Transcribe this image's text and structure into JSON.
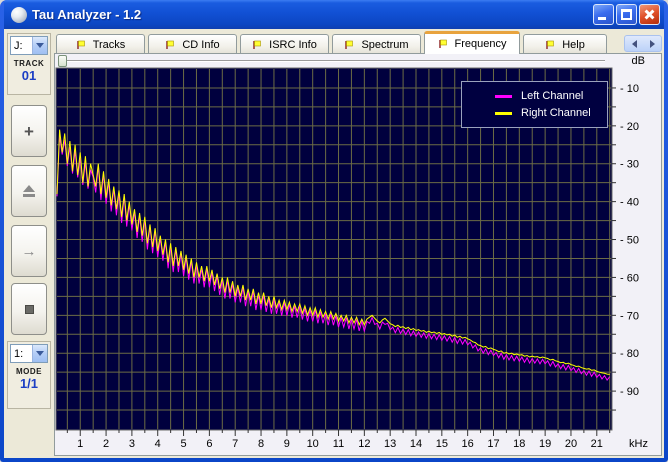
{
  "window": {
    "title": "Tau Analyzer - 1.2"
  },
  "tabs": {
    "items": [
      {
        "label": "Tracks",
        "active": false
      },
      {
        "label": "CD Info",
        "active": false
      },
      {
        "label": "ISRC Info",
        "active": false
      },
      {
        "label": "Spectrum",
        "active": false
      },
      {
        "label": "Frequency",
        "active": true
      },
      {
        "label": "Help",
        "active": false
      }
    ]
  },
  "sidebar": {
    "drive_combo": {
      "value": "J:"
    },
    "track": {
      "label": "TRACK",
      "value": "01"
    },
    "buttons": {
      "add_glyph": "+",
      "play_glyph": "→"
    },
    "mode_combo": {
      "value": "1:"
    },
    "mode": {
      "label": "MODE",
      "value": "1/1"
    }
  },
  "colors": {
    "plot_bg": "#00003e",
    "grid": "#6c6c45",
    "plot_border": "#6a6a6a",
    "tick": "#333333",
    "left_channel": "#ff00ff",
    "right_channel": "#ffff00",
    "active_tab_accent": "#e8a33d"
  },
  "chart_data": {
    "type": "line",
    "title": "",
    "x_unit": "kHz",
    "y_unit": "dB",
    "xlim": [
      0.1,
      21.55
    ],
    "ylim": [
      -100,
      -5
    ],
    "x_grid_step": 0.5,
    "y_grid_step": 5,
    "x_tick_labels": [
      "1",
      "2",
      "3",
      "4",
      "5",
      "6",
      "7",
      "8",
      "9",
      "10",
      "11",
      "12",
      "13",
      "14",
      "15",
      "16",
      "17",
      "18",
      "19",
      "20",
      "21"
    ],
    "y_tick_values": [
      -10,
      -20,
      -30,
      -40,
      -50,
      -60,
      -70,
      -80,
      -90
    ],
    "y_tick_labels": [
      "- 10",
      "- 20",
      "- 30",
      "- 40",
      "- 50",
      "- 60",
      "- 70",
      "- 80",
      "- 90"
    ],
    "legend": {
      "position": "top-right",
      "items": [
        {
          "name": "Left Channel",
          "color": "#ff00ff"
        },
        {
          "name": "Right Channel",
          "color": "#ffff00"
        }
      ]
    },
    "series": [
      {
        "name": "Left Channel",
        "color": "#ff00ff",
        "freq_start": 0.1,
        "freq_step": 0.1,
        "values_db": [
          -38.6,
          -22.6,
          -27.6,
          -23.6,
          -30.6,
          -25.6,
          -32.6,
          -26.6,
          -33.6,
          -28.6,
          -35.6,
          -29.6,
          -36.6,
          -31.6,
          -33.6,
          -37.6,
          -30.6,
          -39.6,
          -32.6,
          -40.6,
          -34.6,
          -42.6,
          -36.6,
          -43.6,
          -37.6,
          -45.6,
          -38.6,
          -46.6,
          -40.6,
          -47.6,
          -42.6,
          -49.6,
          -43.6,
          -50.6,
          -44.6,
          -52.6,
          -46.6,
          -53.6,
          -47.6,
          -54.6,
          -49.6,
          -55.6,
          -50.6,
          -57.6,
          -51.6,
          -58.6,
          -52.6,
          -58.6,
          -53.6,
          -59.6,
          -54.6,
          -60.6,
          -55.6,
          -61.6,
          -56.6,
          -61.6,
          -57.6,
          -62.6,
          -57.6,
          -62.6,
          -58.6,
          -63.6,
          -59.6,
          -64.6,
          -60.6,
          -65.6,
          -60.6,
          -65.6,
          -61.6,
          -66.6,
          -62.6,
          -66.6,
          -62.6,
          -67.6,
          -63.6,
          -67.6,
          -63.6,
          -68.6,
          -64.6,
          -68.6,
          -64.6,
          -69.1,
          -65.6,
          -69.6,
          -65.6,
          -69.6,
          -66.6,
          -70.1,
          -66.6,
          -70.1,
          -67.1,
          -70.6,
          -67.6,
          -70.6,
          -67.6,
          -71.1,
          -68.1,
          -71.6,
          -68.6,
          -71.6,
          -68.6,
          -72.1,
          -69.1,
          -72.1,
          -69.6,
          -72.6,
          -69.6,
          -72.6,
          -70.1,
          -73.1,
          -70.6,
          -73.1,
          -70.6,
          -73.6,
          -71.1,
          -73.6,
          -71.1,
          -74.1,
          -71.6,
          -74.1,
          -71.6,
          -72.1,
          -70.6,
          -72.4,
          -72.1,
          -73.6,
          -71.8,
          -72.4,
          -72.1,
          -73.8,
          -73.1,
          -74.6,
          -73.2,
          -74.8,
          -73.6,
          -75.1,
          -73.8,
          -75.4,
          -74.1,
          -75.6,
          -74.4,
          -75.8,
          -74.6,
          -76.1,
          -74.8,
          -76.2,
          -75.0,
          -76.4,
          -75.1,
          -76.6,
          -75.4,
          -76.8,
          -75.6,
          -77.1,
          -75.8,
          -77.4,
          -76.1,
          -77.6,
          -76.4,
          -77.8,
          -77.1,
          -78.6,
          -77.8,
          -79.4,
          -78.6,
          -80.0,
          -78.8,
          -80.4,
          -79.2,
          -80.6,
          -79.8,
          -81.2,
          -80.0,
          -81.6,
          -80.4,
          -81.8,
          -80.6,
          -82.0,
          -80.8,
          -82.1,
          -81.0,
          -82.4,
          -81.2,
          -82.6,
          -81.4,
          -82.6,
          -81.5,
          -82.8,
          -81.6,
          -82.8,
          -82.0,
          -83.4,
          -82.2,
          -83.6,
          -82.8,
          -84.1,
          -83.0,
          -84.4,
          -83.2,
          -84.6,
          -83.8,
          -85.1,
          -84.0,
          -85.4,
          -84.6,
          -85.8,
          -84.7,
          -86.1,
          -85.0,
          -86.4,
          -85.6,
          -86.8,
          -85.9,
          -87.1,
          -86.2
        ]
      },
      {
        "name": "Right Channel",
        "color": "#ffff00",
        "freq_start": 0.1,
        "freq_step": 0.1,
        "values_db": [
          -38,
          -21,
          -27,
          -22,
          -30,
          -24,
          -32,
          -25,
          -33,
          -27,
          -35,
          -28,
          -36,
          -30,
          -33,
          -36,
          -30,
          -38,
          -32,
          -39,
          -34,
          -41,
          -36,
          -42,
          -37,
          -44,
          -38,
          -45,
          -40,
          -46,
          -42,
          -48,
          -43,
          -49,
          -44,
          -51,
          -46,
          -52,
          -47,
          -53,
          -49,
          -54,
          -50,
          -56,
          -51,
          -57,
          -52,
          -57,
          -53,
          -58,
          -54,
          -59,
          -55,
          -60,
          -56,
          -60,
          -57,
          -61,
          -57,
          -61,
          -58,
          -62,
          -59,
          -63,
          -60,
          -64,
          -60,
          -64,
          -61,
          -65,
          -62,
          -65,
          -62,
          -66,
          -63,
          -66,
          -63,
          -67,
          -64,
          -67,
          -64,
          -67.5,
          -65,
          -68,
          -65,
          -68,
          -66,
          -68.5,
          -66,
          -68.5,
          -66.5,
          -69,
          -67,
          -69,
          -67,
          -69.5,
          -67.5,
          -70,
          -68,
          -70,
          -68,
          -70.5,
          -68.5,
          -70.5,
          -69,
          -71,
          -69,
          -71,
          -69.5,
          -71.5,
          -70,
          -71.5,
          -70,
          -72,
          -70.5,
          -72,
          -70.5,
          -72.5,
          -71,
          -72.5,
          -71,
          -70.5,
          -70,
          -70.8,
          -71.5,
          -72,
          -71.2,
          -70.8,
          -71.5,
          -72.2,
          -72.5,
          -73,
          -72.6,
          -73.2,
          -73,
          -73.5,
          -73.2,
          -73.8,
          -73.5,
          -74,
          -73.8,
          -74.2,
          -74,
          -74.5,
          -74.2,
          -74.6,
          -74.4,
          -74.8,
          -74.5,
          -75,
          -74.8,
          -75.2,
          -75,
          -75.5,
          -75.2,
          -75.8,
          -75.5,
          -76,
          -75.8,
          -76.2,
          -76.5,
          -77,
          -77.2,
          -77.8,
          -78,
          -78.4,
          -78.2,
          -78.8,
          -78.6,
          -79,
          -79.2,
          -79.6,
          -79.4,
          -80,
          -79.8,
          -80.2,
          -80,
          -80.4,
          -80.2,
          -80.5,
          -80.4,
          -80.8,
          -80.6,
          -81,
          -80.8,
          -81,
          -80.9,
          -81.2,
          -81,
          -81.2,
          -81.4,
          -81.8,
          -81.6,
          -82,
          -82.2,
          -82.5,
          -82.4,
          -82.8,
          -82.6,
          -83,
          -83.2,
          -83.5,
          -83.4,
          -83.8,
          -84,
          -84.2,
          -84.1,
          -84.5,
          -84.4,
          -84.8,
          -85,
          -85.2,
          -85.3,
          -85.5,
          -85.6
        ]
      }
    ]
  }
}
